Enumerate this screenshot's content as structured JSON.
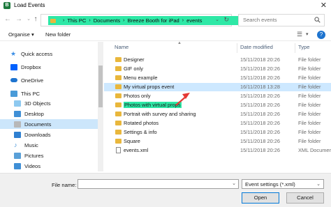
{
  "window": {
    "title": "Load Events",
    "app_icon_letter": "B"
  },
  "address": {
    "crumbs": [
      "This PC",
      "Documents",
      "Breeze Booth for iPad",
      "events"
    ],
    "highlight_color": "#2ee8a6"
  },
  "search": {
    "placeholder": "Search events"
  },
  "toolbar": {
    "organise": "Organise",
    "new_folder": "New folder"
  },
  "navpane": {
    "items": [
      {
        "label": "Quick access",
        "icon": "star-icon",
        "color": "#3a8ee6"
      },
      {
        "label": "Dropbox",
        "icon": "dropbox-icon",
        "color": "#0061fe"
      },
      {
        "label": "OneDrive",
        "icon": "cloud-icon",
        "color": "#1e74cf"
      },
      {
        "label": "This PC",
        "icon": "computer-icon",
        "color": "#4a9bd8"
      },
      {
        "label": "3D Objects",
        "icon": "cube-icon",
        "color": "#8ec9f0"
      },
      {
        "label": "Desktop",
        "icon": "desktop-icon",
        "color": "#3f8fd6"
      },
      {
        "label": "Documents",
        "icon": "document-icon",
        "color": "#b8b8b8"
      },
      {
        "label": "Downloads",
        "icon": "download-icon",
        "color": "#2f80d1"
      },
      {
        "label": "Music",
        "icon": "music-icon",
        "color": "#3f8fd6"
      },
      {
        "label": "Pictures",
        "icon": "pictures-icon",
        "color": "#5aa0d8"
      },
      {
        "label": "Videos",
        "icon": "video-icon",
        "color": "#3f8fd6"
      }
    ]
  },
  "filelist": {
    "columns": {
      "name": "Name",
      "date": "Date modified",
      "type": "Type"
    },
    "rows": [
      {
        "name": "Designer",
        "date": "15/11/2018 20:26",
        "type": "File folder"
      },
      {
        "name": "GIF only",
        "date": "15/11/2018 20:26",
        "type": "File folder"
      },
      {
        "name": "Menu example",
        "date": "15/11/2018 20:26",
        "type": "File folder"
      },
      {
        "name": "My virtual props event",
        "date": "16/11/2018 13:28",
        "type": "File folder"
      },
      {
        "name": "Photos only",
        "date": "15/11/2018 20:26",
        "type": "File folder"
      },
      {
        "name": "Photos with virtual props",
        "date": "15/11/2018 20:26",
        "type": "File folder"
      },
      {
        "name": "Portrait with survey and sharing",
        "date": "15/11/2018 20:26",
        "type": "File folder"
      },
      {
        "name": "Rotated photos",
        "date": "15/11/2018 20:26",
        "type": "File folder"
      },
      {
        "name": "Settings & info",
        "date": "15/11/2018 20:26",
        "type": "File folder"
      },
      {
        "name": "Square",
        "date": "15/11/2018 20:26",
        "type": "File folder"
      },
      {
        "name": "events.xml",
        "date": "15/11/2018 20:26",
        "type": "XML Documen"
      }
    ]
  },
  "bottom": {
    "file_name_label": "File name:",
    "file_name_value": "",
    "filter_value": "Event settings (*.xml)",
    "open_label": "Open",
    "cancel_label": "Cancel"
  },
  "annotation": {
    "arrow_color": "#e53935"
  }
}
